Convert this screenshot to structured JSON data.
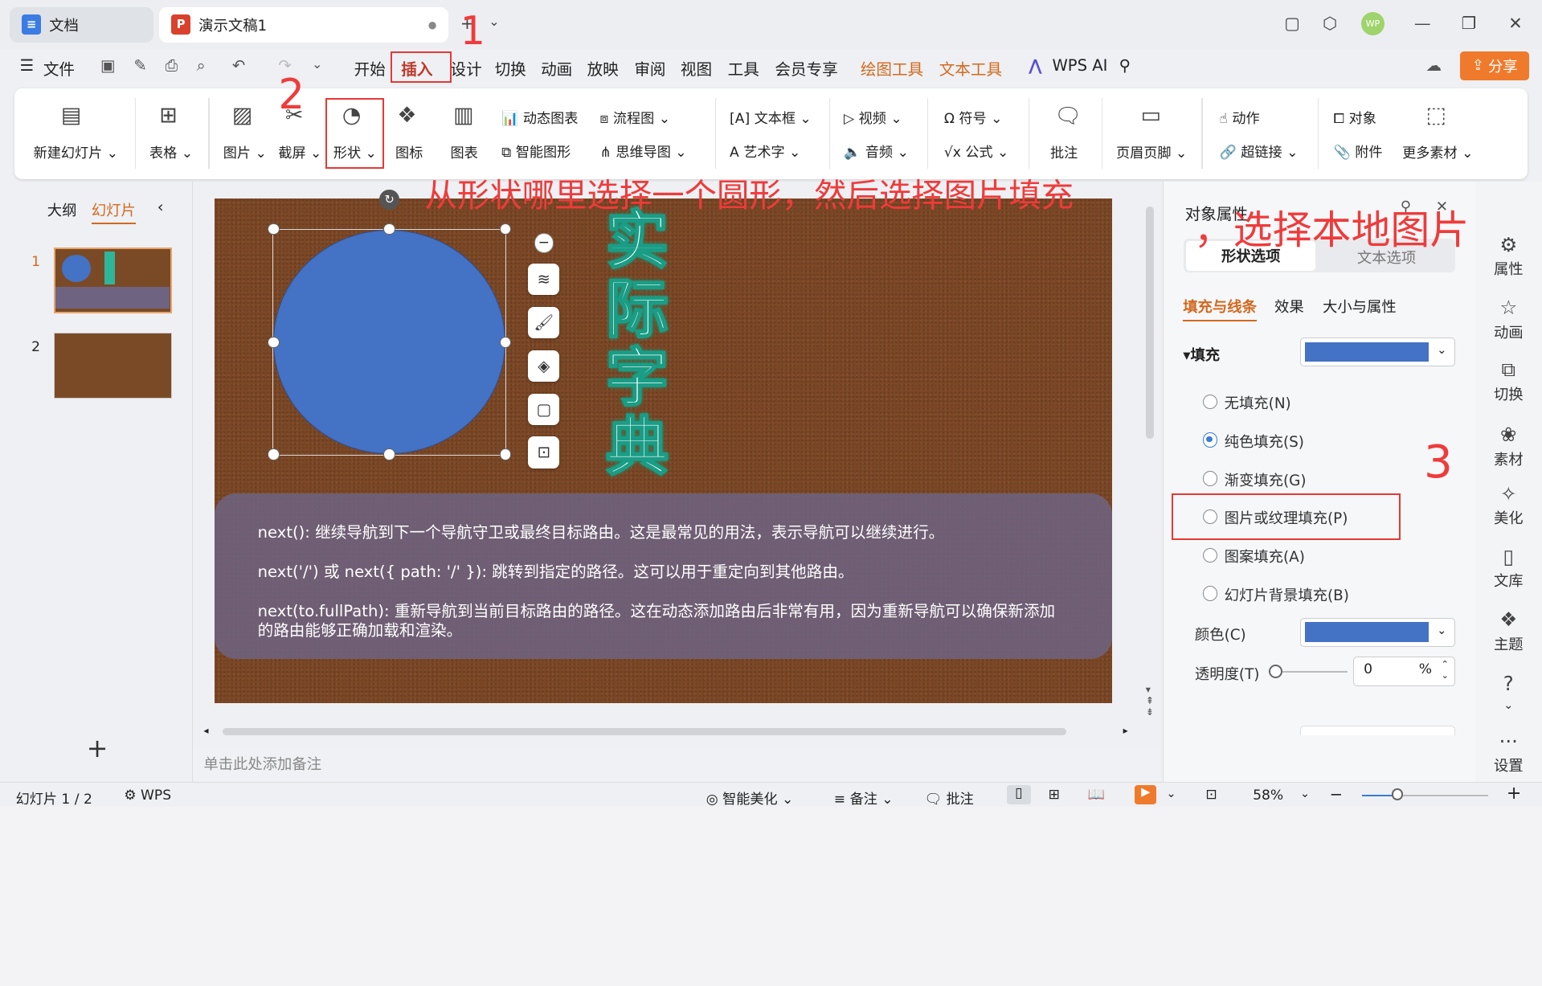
{
  "tabs": [
    {
      "label": "文档",
      "icon": "doc-icon"
    },
    {
      "label": "演示文稿1",
      "icon": "ppt-icon"
    }
  ],
  "title_controls": {
    "avatar": "WP"
  },
  "menu": {
    "file": "文件",
    "items": [
      "开始",
      "插入",
      "设计",
      "切换",
      "动画",
      "放映",
      "审阅",
      "视图",
      "工具",
      "会员专享"
    ],
    "context_items": [
      "绘图工具",
      "文本工具"
    ],
    "ai": "WPS AI",
    "share": "分享"
  },
  "ribbon": {
    "new_slide": "新建幻灯片",
    "table": "表格",
    "picture": "图片",
    "screenshot": "截屏",
    "shape": "形状",
    "icon": "图标",
    "chart": "图表",
    "dynamic_chart": "动态图表",
    "smart_graphic": "智能图形",
    "flowchart": "流程图",
    "mindmap": "思维导图",
    "textbox": "文本框",
    "wordart": "艺术字",
    "video": "视频",
    "audio": "音频",
    "symbol": "符号",
    "formula": "公式",
    "comment": "批注",
    "header_footer": "页眉页脚",
    "action": "动作",
    "hyperlink": "超链接",
    "object": "对象",
    "attachment": "附件",
    "more": "更多素材"
  },
  "left_panel": {
    "outline": "大纲",
    "slides": "幻灯片",
    "numbers": [
      "1",
      "2"
    ]
  },
  "slide": {
    "vertical_title": "实际字典",
    "paragraphs": [
      "next(): 继续导航到下一个导航守卫或最终目标路由。这是最常见的用法，表示导航可以继续进行。",
      "next('/') 或 next({ path: '/' }): 跳转到指定的路径。这可以用于重定向到其他路由。",
      "next(to.fullPath): 重新导航到当前目标路由的路径。这在动态添加路由后非常有用，因为重新导航可以确保新添加的路由能够正确加载和渲染。"
    ]
  },
  "notes_placeholder": "单击此处添加备注",
  "props": {
    "title": "对象属性",
    "tab_shape": "形状选项",
    "tab_text": "文本选项",
    "sub_fill": "填充与线条",
    "sub_effect": "效果",
    "sub_size": "大小与属性",
    "fill_header": "填充",
    "options": [
      "无填充(N)",
      "纯色填充(S)",
      "渐变填充(G)",
      "图片或纹理填充(P)",
      "图案填充(A)",
      "幻灯片背景填充(B)"
    ],
    "color_label": "颜色(C)",
    "transparency_label": "透明度(T)",
    "transparency_value": "0",
    "percent": "%",
    "fill_color": "#4472c4"
  },
  "sidebar": [
    "属性",
    "动画",
    "切换",
    "素材",
    "美化",
    "文库",
    "主题",
    "设置"
  ],
  "status": {
    "slide_info": "幻灯片 1 / 2",
    "wps": "WPS",
    "beautify": "智能美化",
    "notes": "备注",
    "comment": "批注",
    "zoom": "58%"
  },
  "annotations": {
    "n1": "1",
    "n2": "2",
    "n3": "3",
    "instr": "从形状哪里选择一个圆形，然后选择图片填充",
    "instr2": "，选择本地图片"
  }
}
